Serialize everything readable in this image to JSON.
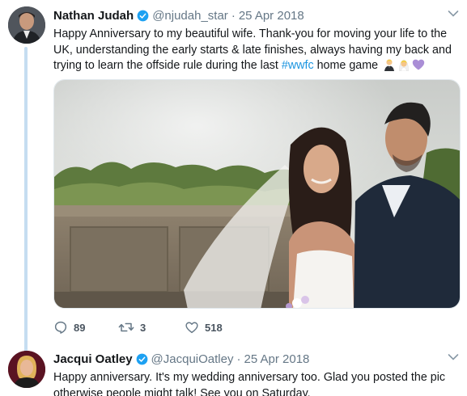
{
  "tweet1": {
    "author_name": "Nathan Judah",
    "author_handle": "@njudah_star",
    "separator": "·",
    "date": "25 Apr 2018",
    "text_before_hashtag": "Happy Anniversary to my beautiful wife. Thank-you for moving your life to the UK, understanding the early starts & late finishes, always having my back and trying to learn the offside rule during the last ",
    "hashtag": "#wwfc",
    "text_after_hashtag": " home game ",
    "emojis": [
      "man-in-tuxedo-emoji",
      "bride-with-veil-emoji",
      "purple-heart-emoji"
    ],
    "replies": "89",
    "retweets": "3",
    "likes": "518"
  },
  "tweet2": {
    "author_name": "Jacqui Oatley",
    "author_handle": "@JacquiOatley",
    "separator": "·",
    "date": "25 Apr 2018",
    "text": "Happy anniversary. It's my wedding anniversary too. Glad you posted the pic otherwise people might talk! See you on Saturday."
  },
  "colors": {
    "link": "#1b95e0",
    "verified": "#1da1f2",
    "secondary_text": "#657786",
    "thread_line": "#c5ddf1"
  }
}
